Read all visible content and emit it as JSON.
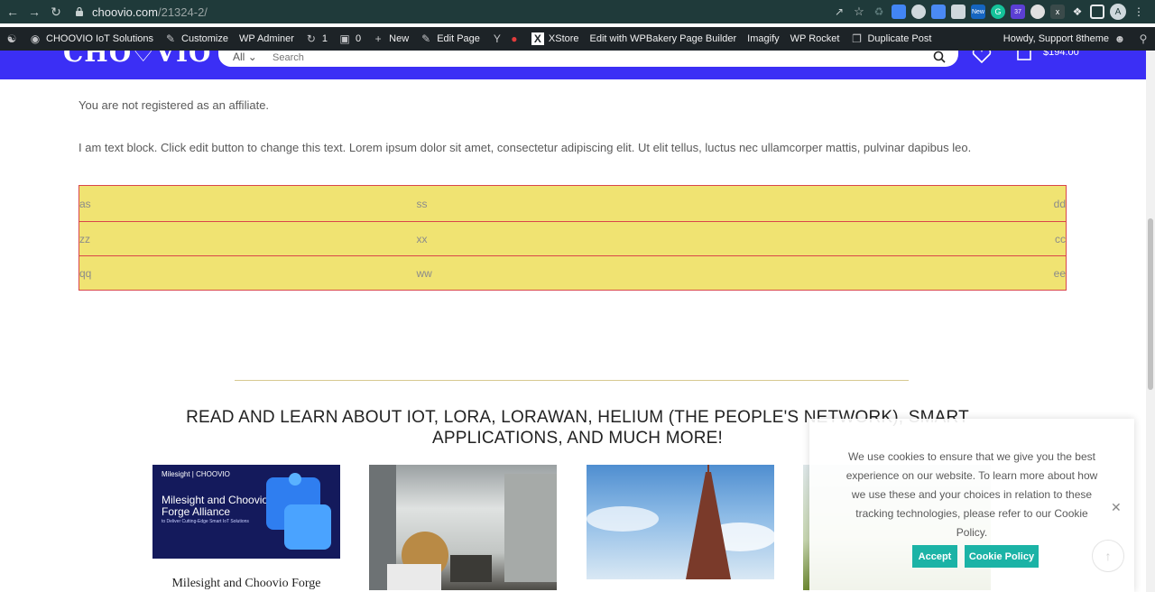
{
  "browser": {
    "url_host": "choovio.com",
    "url_path": "/21324-2/",
    "extension_badge": "37",
    "new_badge": "New",
    "profile_initial": "A"
  },
  "wp_admin_bar": {
    "site_name": "CHOOVIO IoT Solutions",
    "customize": "Customize",
    "wp_adminer": "WP Adminer",
    "updates_count": "1",
    "comments_count": "0",
    "new": "New",
    "edit_page": "Edit Page",
    "xstore": "XStore",
    "wpbakery": "Edit with WPBakery Page Builder",
    "imagify": "Imagify",
    "wp_rocket": "WP Rocket",
    "duplicate_post": "Duplicate Post",
    "howdy": "Howdy, Support 8theme"
  },
  "site_header": {
    "logo": "CHO♡VIO",
    "search_category": "All",
    "search_placeholder": "Search",
    "cart_total": "$194.00"
  },
  "content": {
    "affiliate_notice": "You are not registered as an affiliate.",
    "text_block": "I am text block. Click edit button to change this text. Lorem ipsum dolor sit amet, consectetur adipiscing elit. Ut elit tellus, luctus nec ullamcorper mattis, pulvinar dapibus leo.",
    "table": [
      [
        "as",
        "ss",
        "dd"
      ],
      [
        "zz",
        "xx",
        "cc"
      ],
      [
        "qq",
        "ww",
        "ee"
      ]
    ]
  },
  "blog": {
    "heading_line1": "READ AND LEARN ABOUT IOT, LORA, LORAWAN, HELIUM (THE PEOPLE'S NETWORK), SMART",
    "heading_line2": "APPLICATIONS, AND MUCH MORE!",
    "card1_brand": "Milesight | CHOOVIO",
    "card1_image_title": "Milesight and Choovio Forge Alliance",
    "card1_image_sub": "to Deliver Cutting-Edge Smart IoT Solutions",
    "card1_title": "Milesight and Choovio Forge"
  },
  "cookie": {
    "message": "We use cookies to ensure that we give you the best experience on our website. To learn more about how we use these and your choices in relation to these tracking technologies, please refer to our Cookie Policy.",
    "accept": "Accept",
    "policy": "Cookie Policy"
  },
  "colors": {
    "header_blue": "#3b2ff5",
    "table_yellow": "#f0e372",
    "table_border": "#d9464a",
    "cookie_button": "#1bb3a6"
  }
}
